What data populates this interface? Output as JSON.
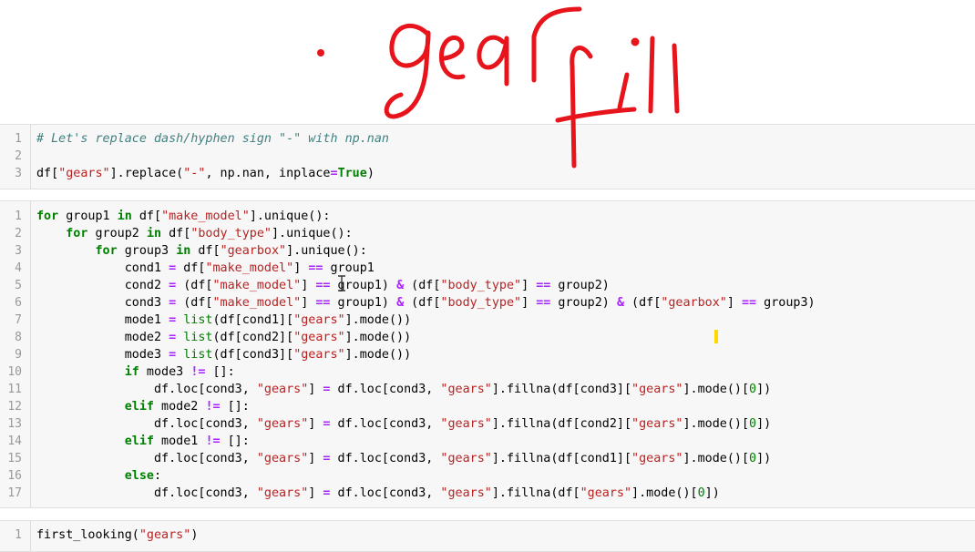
{
  "annotation": {
    "word1": "gear",
    "word2": "fill",
    "color": "#e8141c"
  },
  "colors": {
    "keyword": "#008000",
    "string": "#ba2121",
    "operator": "#aa22ff",
    "comment": "#408080",
    "cell_bg": "#f7f7f7",
    "line_number": "#999999",
    "marker": "#ffd800"
  },
  "cells": [
    {
      "lines": [
        {
          "n": "1",
          "tokens": [
            {
              "t": "# Let's replace dash/hyphen sign \"-\" with np.nan",
              "c": "cm"
            }
          ]
        },
        {
          "n": "2",
          "tokens": []
        },
        {
          "n": "3",
          "tokens": [
            {
              "t": "df[",
              "c": ""
            },
            {
              "t": "\"gears\"",
              "c": "st"
            },
            {
              "t": "].replace(",
              "c": ""
            },
            {
              "t": "\"-\"",
              "c": "st"
            },
            {
              "t": ", np.nan, inplace",
              "c": ""
            },
            {
              "t": "=",
              "c": "op"
            },
            {
              "t": "True",
              "c": "bool"
            },
            {
              "t": ")",
              "c": ""
            }
          ]
        }
      ]
    },
    {
      "lines": [
        {
          "n": "1",
          "tokens": [
            {
              "t": "for",
              "c": "kw"
            },
            {
              "t": " group1 ",
              "c": ""
            },
            {
              "t": "in",
              "c": "kw"
            },
            {
              "t": " df[",
              "c": ""
            },
            {
              "t": "\"make_model\"",
              "c": "st"
            },
            {
              "t": "].unique():",
              "c": ""
            }
          ]
        },
        {
          "n": "2",
          "tokens": [
            {
              "t": "    ",
              "c": ""
            },
            {
              "t": "for",
              "c": "kw"
            },
            {
              "t": " group2 ",
              "c": ""
            },
            {
              "t": "in",
              "c": "kw"
            },
            {
              "t": " df[",
              "c": ""
            },
            {
              "t": "\"body_type\"",
              "c": "st"
            },
            {
              "t": "].unique():",
              "c": ""
            }
          ]
        },
        {
          "n": "3",
          "tokens": [
            {
              "t": "        ",
              "c": ""
            },
            {
              "t": "for",
              "c": "kw"
            },
            {
              "t": " group3 ",
              "c": ""
            },
            {
              "t": "in",
              "c": "kw"
            },
            {
              "t": " df[",
              "c": ""
            },
            {
              "t": "\"gearbox\"",
              "c": "st"
            },
            {
              "t": "].unique():",
              "c": ""
            }
          ]
        },
        {
          "n": "4",
          "tokens": [
            {
              "t": "            cond1 ",
              "c": ""
            },
            {
              "t": "=",
              "c": "op"
            },
            {
              "t": " df[",
              "c": ""
            },
            {
              "t": "\"make_model\"",
              "c": "st"
            },
            {
              "t": "] ",
              "c": ""
            },
            {
              "t": "==",
              "c": "op"
            },
            {
              "t": " group1",
              "c": ""
            }
          ]
        },
        {
          "n": "5",
          "tokens": [
            {
              "t": "            cond2 ",
              "c": ""
            },
            {
              "t": "=",
              "c": "op"
            },
            {
              "t": " (df[",
              "c": ""
            },
            {
              "t": "\"make_model\"",
              "c": "st"
            },
            {
              "t": "] ",
              "c": ""
            },
            {
              "t": "==",
              "c": "op"
            },
            {
              "t": " group1) ",
              "c": ""
            },
            {
              "t": "&",
              "c": "op"
            },
            {
              "t": " (df[",
              "c": ""
            },
            {
              "t": "\"body_type\"",
              "c": "st"
            },
            {
              "t": "] ",
              "c": ""
            },
            {
              "t": "==",
              "c": "op"
            },
            {
              "t": " group2)",
              "c": ""
            }
          ]
        },
        {
          "n": "6",
          "tokens": [
            {
              "t": "            cond3 ",
              "c": ""
            },
            {
              "t": "=",
              "c": "op"
            },
            {
              "t": " (df[",
              "c": ""
            },
            {
              "t": "\"make_model\"",
              "c": "st"
            },
            {
              "t": "] ",
              "c": ""
            },
            {
              "t": "==",
              "c": "op"
            },
            {
              "t": " group1) ",
              "c": ""
            },
            {
              "t": "&",
              "c": "op"
            },
            {
              "t": " (df[",
              "c": ""
            },
            {
              "t": "\"body_type\"",
              "c": "st"
            },
            {
              "t": "] ",
              "c": ""
            },
            {
              "t": "==",
              "c": "op"
            },
            {
              "t": " group2) ",
              "c": ""
            },
            {
              "t": "&",
              "c": "op"
            },
            {
              "t": " (df[",
              "c": ""
            },
            {
              "t": "\"gearbox\"",
              "c": "st"
            },
            {
              "t": "] ",
              "c": ""
            },
            {
              "t": "==",
              "c": "op"
            },
            {
              "t": " group3)",
              "c": ""
            }
          ]
        },
        {
          "n": "7",
          "tokens": [
            {
              "t": "            mode1 ",
              "c": ""
            },
            {
              "t": "=",
              "c": "op"
            },
            {
              "t": " ",
              "c": ""
            },
            {
              "t": "list",
              "c": "bi"
            },
            {
              "t": "(df[cond1][",
              "c": ""
            },
            {
              "t": "\"gears\"",
              "c": "st"
            },
            {
              "t": "].mode())",
              "c": ""
            }
          ]
        },
        {
          "n": "8",
          "tokens": [
            {
              "t": "            mode2 ",
              "c": ""
            },
            {
              "t": "=",
              "c": "op"
            },
            {
              "t": " ",
              "c": ""
            },
            {
              "t": "list",
              "c": "bi"
            },
            {
              "t": "(df[cond2][",
              "c": ""
            },
            {
              "t": "\"gears\"",
              "c": "st"
            },
            {
              "t": "].mode())",
              "c": ""
            }
          ]
        },
        {
          "n": "9",
          "tokens": [
            {
              "t": "            mode3 ",
              "c": ""
            },
            {
              "t": "=",
              "c": "op"
            },
            {
              "t": " ",
              "c": ""
            },
            {
              "t": "list",
              "c": "bi"
            },
            {
              "t": "(df[cond3][",
              "c": ""
            },
            {
              "t": "\"gears\"",
              "c": "st"
            },
            {
              "t": "].mode())",
              "c": ""
            }
          ]
        },
        {
          "n": "10",
          "tokens": [
            {
              "t": "            ",
              "c": ""
            },
            {
              "t": "if",
              "c": "kw"
            },
            {
              "t": " mode3 ",
              "c": ""
            },
            {
              "t": "!=",
              "c": "op"
            },
            {
              "t": " []:",
              "c": ""
            }
          ]
        },
        {
          "n": "11",
          "tokens": [
            {
              "t": "                df.loc[cond3, ",
              "c": ""
            },
            {
              "t": "\"gears\"",
              "c": "st"
            },
            {
              "t": "] ",
              "c": ""
            },
            {
              "t": "=",
              "c": "op"
            },
            {
              "t": " df.loc[cond3, ",
              "c": ""
            },
            {
              "t": "\"gears\"",
              "c": "st"
            },
            {
              "t": "].fillna(df[cond3][",
              "c": ""
            },
            {
              "t": "\"gears\"",
              "c": "st"
            },
            {
              "t": "].mode()[",
              "c": ""
            },
            {
              "t": "0",
              "c": "nm"
            },
            {
              "t": "])",
              "c": ""
            }
          ]
        },
        {
          "n": "12",
          "tokens": [
            {
              "t": "            ",
              "c": ""
            },
            {
              "t": "elif",
              "c": "kw"
            },
            {
              "t": " mode2 ",
              "c": ""
            },
            {
              "t": "!=",
              "c": "op"
            },
            {
              "t": " []:",
              "c": ""
            }
          ]
        },
        {
          "n": "13",
          "tokens": [
            {
              "t": "                df.loc[cond3, ",
              "c": ""
            },
            {
              "t": "\"gears\"",
              "c": "st"
            },
            {
              "t": "] ",
              "c": ""
            },
            {
              "t": "=",
              "c": "op"
            },
            {
              "t": " df.loc[cond3, ",
              "c": ""
            },
            {
              "t": "\"gears\"",
              "c": "st"
            },
            {
              "t": "].fillna(df[cond2][",
              "c": ""
            },
            {
              "t": "\"gears\"",
              "c": "st"
            },
            {
              "t": "].mode()[",
              "c": ""
            },
            {
              "t": "0",
              "c": "nm"
            },
            {
              "t": "])",
              "c": ""
            }
          ]
        },
        {
          "n": "14",
          "tokens": [
            {
              "t": "            ",
              "c": ""
            },
            {
              "t": "elif",
              "c": "kw"
            },
            {
              "t": " mode1 ",
              "c": ""
            },
            {
              "t": "!=",
              "c": "op"
            },
            {
              "t": " []:",
              "c": ""
            }
          ]
        },
        {
          "n": "15",
          "tokens": [
            {
              "t": "                df.loc[cond3, ",
              "c": ""
            },
            {
              "t": "\"gears\"",
              "c": "st"
            },
            {
              "t": "] ",
              "c": ""
            },
            {
              "t": "=",
              "c": "op"
            },
            {
              "t": " df.loc[cond3, ",
              "c": ""
            },
            {
              "t": "\"gears\"",
              "c": "st"
            },
            {
              "t": "].fillna(df[cond1][",
              "c": ""
            },
            {
              "t": "\"gears\"",
              "c": "st"
            },
            {
              "t": "].mode()[",
              "c": ""
            },
            {
              "t": "0",
              "c": "nm"
            },
            {
              "t": "])",
              "c": ""
            }
          ]
        },
        {
          "n": "16",
          "tokens": [
            {
              "t": "            ",
              "c": ""
            },
            {
              "t": "else",
              "c": "kw"
            },
            {
              "t": ":",
              "c": ""
            }
          ]
        },
        {
          "n": "17",
          "tokens": [
            {
              "t": "                df.loc[cond3, ",
              "c": ""
            },
            {
              "t": "\"gears\"",
              "c": "st"
            },
            {
              "t": "] ",
              "c": ""
            },
            {
              "t": "=",
              "c": "op"
            },
            {
              "t": " df.loc[cond3, ",
              "c": ""
            },
            {
              "t": "\"gears\"",
              "c": "st"
            },
            {
              "t": "].fillna(df[",
              "c": ""
            },
            {
              "t": "\"gears\"",
              "c": "st"
            },
            {
              "t": "].mode()[",
              "c": ""
            },
            {
              "t": "0",
              "c": "nm"
            },
            {
              "t": "])",
              "c": ""
            }
          ]
        }
      ]
    },
    {
      "lines": [
        {
          "n": "1",
          "tokens": [
            {
              "t": "first_looking(",
              "c": ""
            },
            {
              "t": "\"gears\"",
              "c": "st"
            },
            {
              "t": ")",
              "c": ""
            }
          ]
        }
      ]
    }
  ]
}
